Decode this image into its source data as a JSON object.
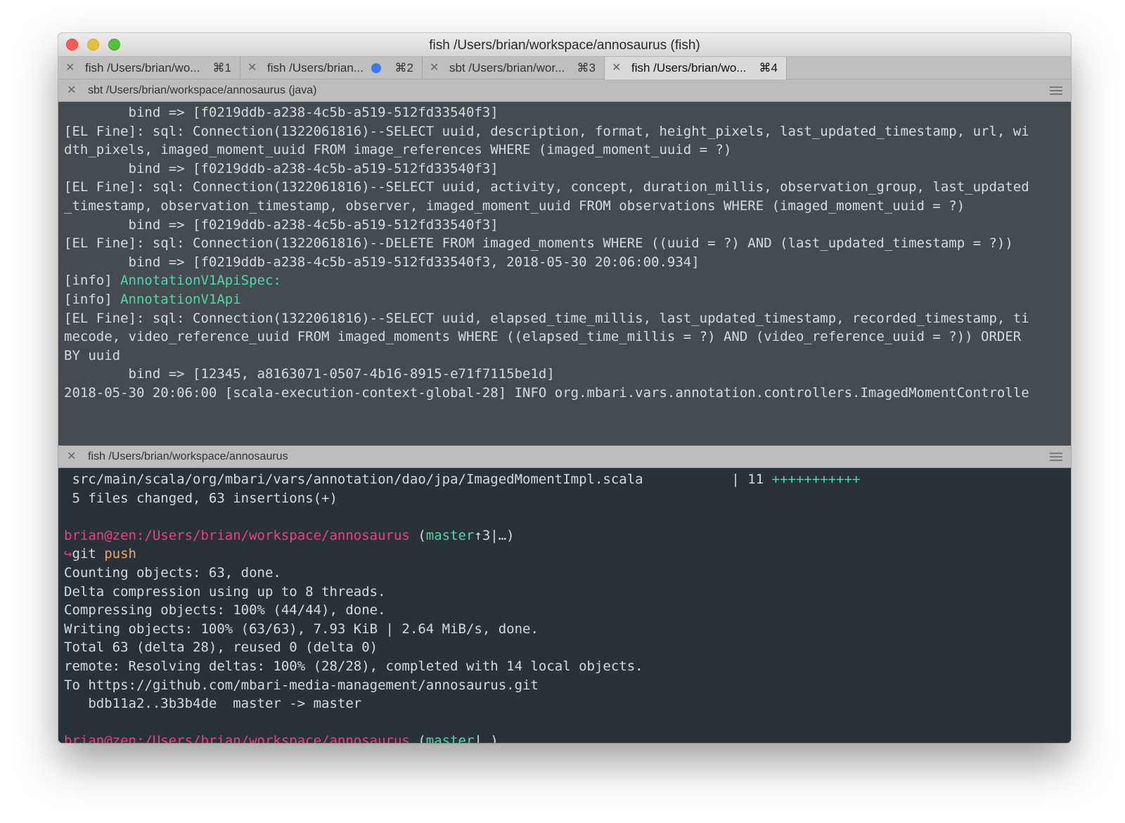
{
  "window": {
    "title": "fish  /Users/brian/workspace/annosaurus (fish)"
  },
  "tabs": [
    {
      "label": "fish  /Users/brian/wo...",
      "shortcut": "⌘1"
    },
    {
      "label": "fish  /Users/brian...",
      "shortcut": "⌘2",
      "has_dot": true
    },
    {
      "label": "sbt  /Users/brian/wor...",
      "shortcut": "⌘3"
    },
    {
      "label": "fish  /Users/brian/wo...",
      "shortcut": "⌘4",
      "active": true
    }
  ],
  "top_pane": {
    "header": "sbt  /Users/brian/workspace/annosaurus (java)",
    "lines": [
      "        bind => [f0219ddb-a238-4c5b-a519-512fd33540f3]",
      "[EL Fine]: sql: Connection(1322061816)--SELECT uuid, description, format, height_pixels, last_updated_timestamp, url, wi",
      "dth_pixels, imaged_moment_uuid FROM image_references WHERE (imaged_moment_uuid = ?)",
      "        bind => [f0219ddb-a238-4c5b-a519-512fd33540f3]",
      "[EL Fine]: sql: Connection(1322061816)--SELECT uuid, activity, concept, duration_millis, observation_group, last_updated",
      "_timestamp, observation_timestamp, observer, imaged_moment_uuid FROM observations WHERE (imaged_moment_uuid = ?)",
      "        bind => [f0219ddb-a238-4c5b-a519-512fd33540f3]",
      "[EL Fine]: sql: Connection(1322061816)--DELETE FROM imaged_moments WHERE ((uuid = ?) AND (last_updated_timestamp = ?))",
      "        bind => [f0219ddb-a238-4c5b-a519-512fd33540f3, 2018-05-30 20:06:00.934]",
      "",
      "",
      "[EL Fine]: sql: Connection(1322061816)--SELECT uuid, elapsed_time_millis, last_updated_timestamp, recorded_timestamp, ti",
      "mecode, video_reference_uuid FROM imaged_moments WHERE ((elapsed_time_millis = ?) AND (video_reference_uuid = ?)) ORDER",
      "BY uuid",
      "        bind => [12345, a8163071-0507-4b16-8915-e71f7115be1d]",
      "2018-05-30 20:06:00 [scala-execution-context-global-28] INFO org.mbari.vars.annotation.controllers.ImagedMomentControlle"
    ],
    "info_prefix": "[info] ",
    "info_spec": "AnnotationV1ApiSpec:",
    "info_api": "AnnotationV1Api"
  },
  "bottom_pane": {
    "header": "fish  /Users/brian/workspace/annosaurus",
    "diffstat_file": " src/main/scala/org/mbari/vars/annotation/dao/jpa/ImagedMomentImpl.scala           | 11 ",
    "diffstat_plus": "+++++++++++",
    "summary": " 5 files changed, 63 insertions(+)",
    "prompt_path": "brian@zen:/Users/brian/workspace/annosaurus",
    "prompt1_open": " (",
    "prompt1_branch": "master",
    "prompt1_rest": "↑3|…)",
    "arrow": "↪",
    "cmd": "git",
    "cmd_arg": " push",
    "output": [
      "Counting objects: 63, done.",
      "Delta compression using up to 8 threads.",
      "Compressing objects: 100% (44/44), done.",
      "Writing objects: 100% (63/63), 7.93 KiB | 2.64 MiB/s, done.",
      "Total 63 (delta 28), reused 0 (delta 0)",
      "remote: Resolving deltas: 100% (28/28), completed with 14 local objects.",
      "To https://github.com/mbari-media-management/annosaurus.git",
      "   bdb11a2..3b3b4de  master -> master"
    ],
    "prompt2_open": " (",
    "prompt2_branch": "master",
    "prompt2_rest": "|…)"
  }
}
